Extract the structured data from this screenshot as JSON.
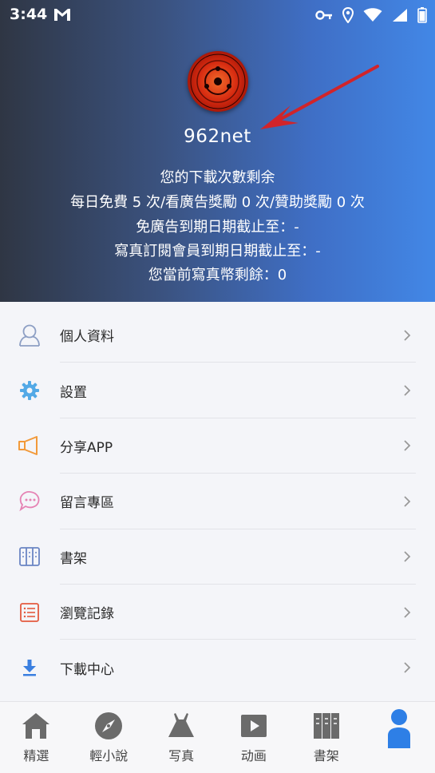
{
  "status_bar": {
    "time": "3:44",
    "icons": [
      "gmail-icon",
      "vpn-key-icon",
      "location-icon",
      "wifi-icon",
      "signal-icon",
      "battery-icon"
    ]
  },
  "profile": {
    "avatar": "avatar-icon",
    "nickname": "962net",
    "download_title": "您的下載次數剩余",
    "download_detail": "每日免費 5 次/看廣告獎勵 0 次/贊助獎勵 0 次",
    "ad_free_expiry": "免廣告到期日期截止至：-",
    "photo_member_expiry": "寫真訂閱會員到期日期截止至：-",
    "photo_coins": "您當前寫真幣剩餘：0"
  },
  "menu": {
    "items": [
      {
        "label": "個人資料",
        "icon": "person-icon"
      },
      {
        "label": "設置",
        "icon": "gear-icon"
      },
      {
        "label": "分享APP",
        "icon": "megaphone-icon"
      },
      {
        "label": "留言專區",
        "icon": "chat-bubbles-icon"
      },
      {
        "label": "書架",
        "icon": "bookshelf-icon"
      },
      {
        "label": "瀏覽記錄",
        "icon": "list-icon"
      },
      {
        "label": "下載中心",
        "icon": "download-icon"
      }
    ]
  },
  "bottom_nav": {
    "items": [
      {
        "label": "精選",
        "icon": "home-icon"
      },
      {
        "label": "輕小說",
        "icon": "compass-icon"
      },
      {
        "label": "写真",
        "icon": "dress-icon"
      },
      {
        "label": "动画",
        "icon": "play-icon"
      },
      {
        "label": "書架",
        "icon": "bookshelf-icon"
      },
      {
        "label": "",
        "icon": "user-icon",
        "active": true
      }
    ]
  },
  "colors": {
    "accent": "#3f7fe0",
    "header_dark": "#2f3644",
    "header_light": "#4287e6",
    "arrow": "#d1242a"
  }
}
